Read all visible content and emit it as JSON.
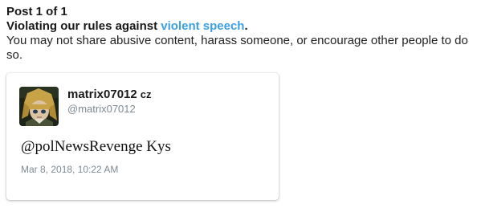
{
  "header": {
    "post_count": "Post 1 of 1",
    "violation_prefix": "Violating our rules against ",
    "violation_link": "violent speech",
    "violation_suffix": ".",
    "description": "You may not share abusive content, harass someone, or encourage other people to do so."
  },
  "tweet": {
    "display_name": "matrix07012",
    "flag": "cz",
    "username": "@matrix07012",
    "text": "@polNewsRevenge Kys",
    "timestamp": "Mar 8, 2018, 10:22 AM",
    "avatar_icon": "anime-character-avatar"
  },
  "colors": {
    "link": "#3ea0e0",
    "muted": "#7d8a94"
  }
}
